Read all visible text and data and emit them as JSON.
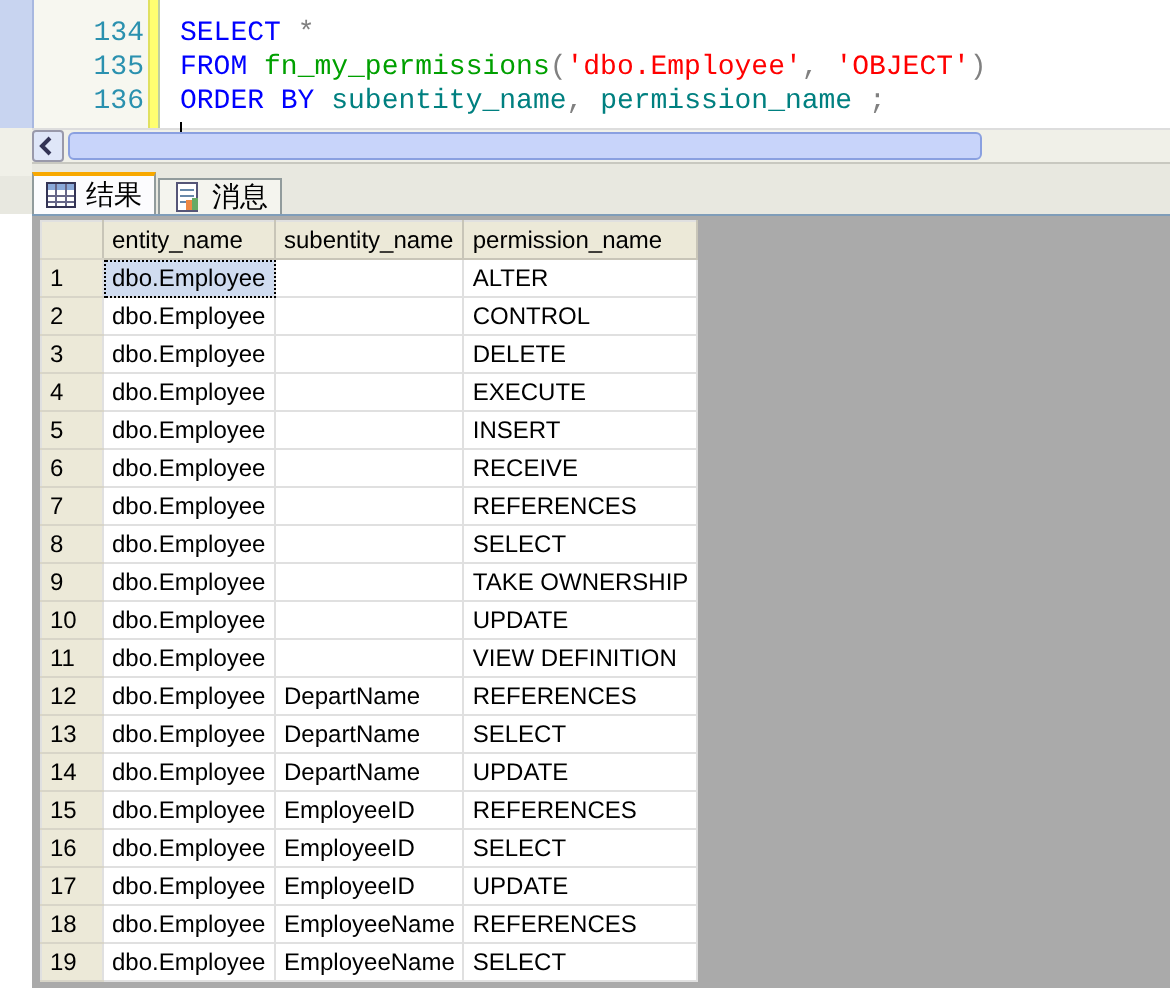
{
  "editor": {
    "lines": [
      {
        "number": "134",
        "tokens": [
          {
            "kind": "keyword",
            "text": "SELECT"
          },
          {
            "kind": "operator",
            "text": " *"
          }
        ]
      },
      {
        "number": "135",
        "tokens": [
          {
            "kind": "keyword",
            "text": "FROM "
          },
          {
            "kind": "function",
            "text": "fn_my_permissions"
          },
          {
            "kind": "operator",
            "text": "("
          },
          {
            "kind": "string",
            "text": "'dbo.Employee'"
          },
          {
            "kind": "operator",
            "text": ", "
          },
          {
            "kind": "string",
            "text": "'OBJECT'"
          },
          {
            "kind": "operator",
            "text": ")"
          }
        ]
      },
      {
        "number": "136",
        "tokens": [
          {
            "kind": "keyword",
            "text": "ORDER BY "
          },
          {
            "kind": "identifier",
            "text": "subentity_name"
          },
          {
            "kind": "operator",
            "text": ", "
          },
          {
            "kind": "identifier",
            "text": "permission_name"
          },
          {
            "kind": "operator",
            "text": " ;"
          }
        ]
      }
    ]
  },
  "result_tabs": [
    {
      "label": "结果",
      "kind": "grid",
      "selected": true
    },
    {
      "label": "消息",
      "kind": "document",
      "selected": false
    }
  ],
  "table": {
    "columns": [
      "entity_name",
      "subentity_name",
      "permission_name"
    ],
    "rows": [
      {
        "number": "1",
        "cells": [
          "dbo.Employee",
          "",
          "ALTER"
        ],
        "selected": true
      },
      {
        "number": "2",
        "cells": [
          "dbo.Employee",
          "",
          "CONTROL"
        ],
        "selected": false
      },
      {
        "number": "3",
        "cells": [
          "dbo.Employee",
          "",
          "DELETE"
        ],
        "selected": false
      },
      {
        "number": "4",
        "cells": [
          "dbo.Employee",
          "",
          "EXECUTE"
        ],
        "selected": false
      },
      {
        "number": "5",
        "cells": [
          "dbo.Employee",
          "",
          "INSERT"
        ],
        "selected": false
      },
      {
        "number": "6",
        "cells": [
          "dbo.Employee",
          "",
          "RECEIVE"
        ],
        "selected": false
      },
      {
        "number": "7",
        "cells": [
          "dbo.Employee",
          "",
          "REFERENCES"
        ],
        "selected": false
      },
      {
        "number": "8",
        "cells": [
          "dbo.Employee",
          "",
          "SELECT"
        ],
        "selected": false
      },
      {
        "number": "9",
        "cells": [
          "dbo.Employee",
          "",
          "TAKE OWNERSHIP"
        ],
        "selected": false
      },
      {
        "number": "10",
        "cells": [
          "dbo.Employee",
          "",
          "UPDATE"
        ],
        "selected": false
      },
      {
        "number": "11",
        "cells": [
          "dbo.Employee",
          "",
          "VIEW DEFINITION"
        ],
        "selected": false
      },
      {
        "number": "12",
        "cells": [
          "dbo.Employee",
          "DepartName",
          "REFERENCES"
        ],
        "selected": false
      },
      {
        "number": "13",
        "cells": [
          "dbo.Employee",
          "DepartName",
          "SELECT"
        ],
        "selected": false
      },
      {
        "number": "14",
        "cells": [
          "dbo.Employee",
          "DepartName",
          "UPDATE"
        ],
        "selected": false
      },
      {
        "number": "15",
        "cells": [
          "dbo.Employee",
          "EmployeeID",
          "REFERENCES"
        ],
        "selected": false
      },
      {
        "number": "16",
        "cells": [
          "dbo.Employee",
          "EmployeeID",
          "SELECT"
        ],
        "selected": false
      },
      {
        "number": "17",
        "cells": [
          "dbo.Employee",
          "EmployeeID",
          "UPDATE"
        ],
        "selected": false
      },
      {
        "number": "18",
        "cells": [
          "dbo.Employee",
          "EmployeeName",
          "REFERENCES"
        ],
        "selected": false
      },
      {
        "number": "19",
        "cells": [
          "dbo.Employee",
          "EmployeeName",
          "SELECT"
        ],
        "selected": false
      }
    ]
  }
}
